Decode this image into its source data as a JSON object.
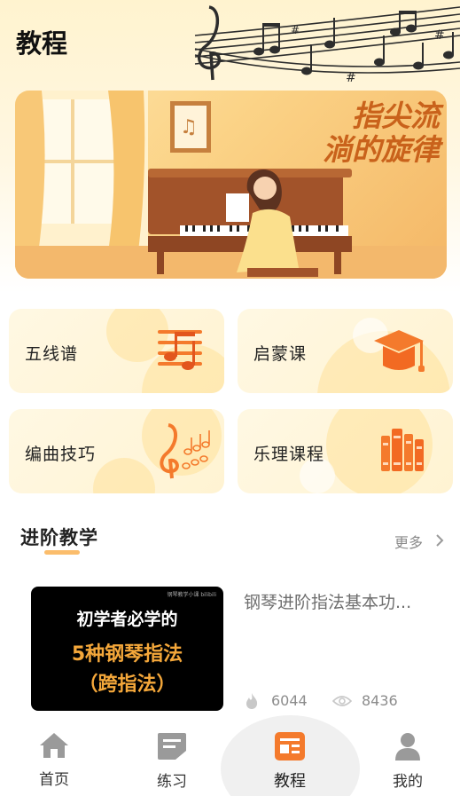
{
  "header": {
    "title": "教程"
  },
  "banner": {
    "line1": "指尖流",
    "line2": "淌的旋律",
    "sub": "......"
  },
  "categories": [
    {
      "label": "五线谱",
      "icon": "staff-notes-icon"
    },
    {
      "label": "启蒙课",
      "icon": "graduation-cap-icon"
    },
    {
      "label": "编曲技巧",
      "icon": "treble-clef-icon"
    },
    {
      "label": "乐理课程",
      "icon": "books-icon"
    }
  ],
  "section": {
    "title": "进阶教学",
    "more_label": "更多"
  },
  "course": {
    "thumb_tag": "钢琴教学小课 bilibili",
    "thumb_line1": "初学者必学的",
    "thumb_line2": "5种钢琴指法",
    "thumb_line3": "（跨指法）",
    "title": "钢琴进阶指法基本功...",
    "likes": "6044",
    "views": "8436"
  },
  "nav": [
    {
      "label": "首页",
      "icon": "home-icon"
    },
    {
      "label": "练习",
      "icon": "practice-icon"
    },
    {
      "label": "教程",
      "icon": "tutorial-icon"
    },
    {
      "label": "我的",
      "icon": "profile-icon"
    }
  ],
  "colors": {
    "accent": "#f47a2c",
    "accent_light": "#fbbd6c",
    "nav_icon": "#9a9a9a"
  }
}
